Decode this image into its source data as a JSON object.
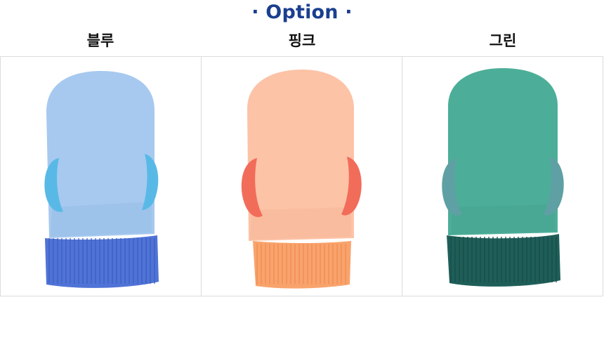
{
  "header": {
    "title": "· Option ·"
  },
  "options": [
    {
      "label": "블루",
      "body_color": "#a7c9ef",
      "body_shade": "#8db6e6",
      "loop_color": "#59b9e6",
      "cuff_color": "#4f73d6",
      "cuff_line": "#3d5fc2"
    },
    {
      "label": "핑크",
      "body_color": "#fcc3a6",
      "body_shade": "#f6ab8c",
      "loop_color": "#f26c5a",
      "cuff_color": "#f9a36c",
      "cuff_line": "#ee8d55"
    },
    {
      "label": "그린",
      "body_color": "#4cae98",
      "body_shade": "#3f9c87",
      "loop_color": "#5fa0a4",
      "cuff_color": "#1f5e58",
      "cuff_line": "#174d48"
    }
  ]
}
